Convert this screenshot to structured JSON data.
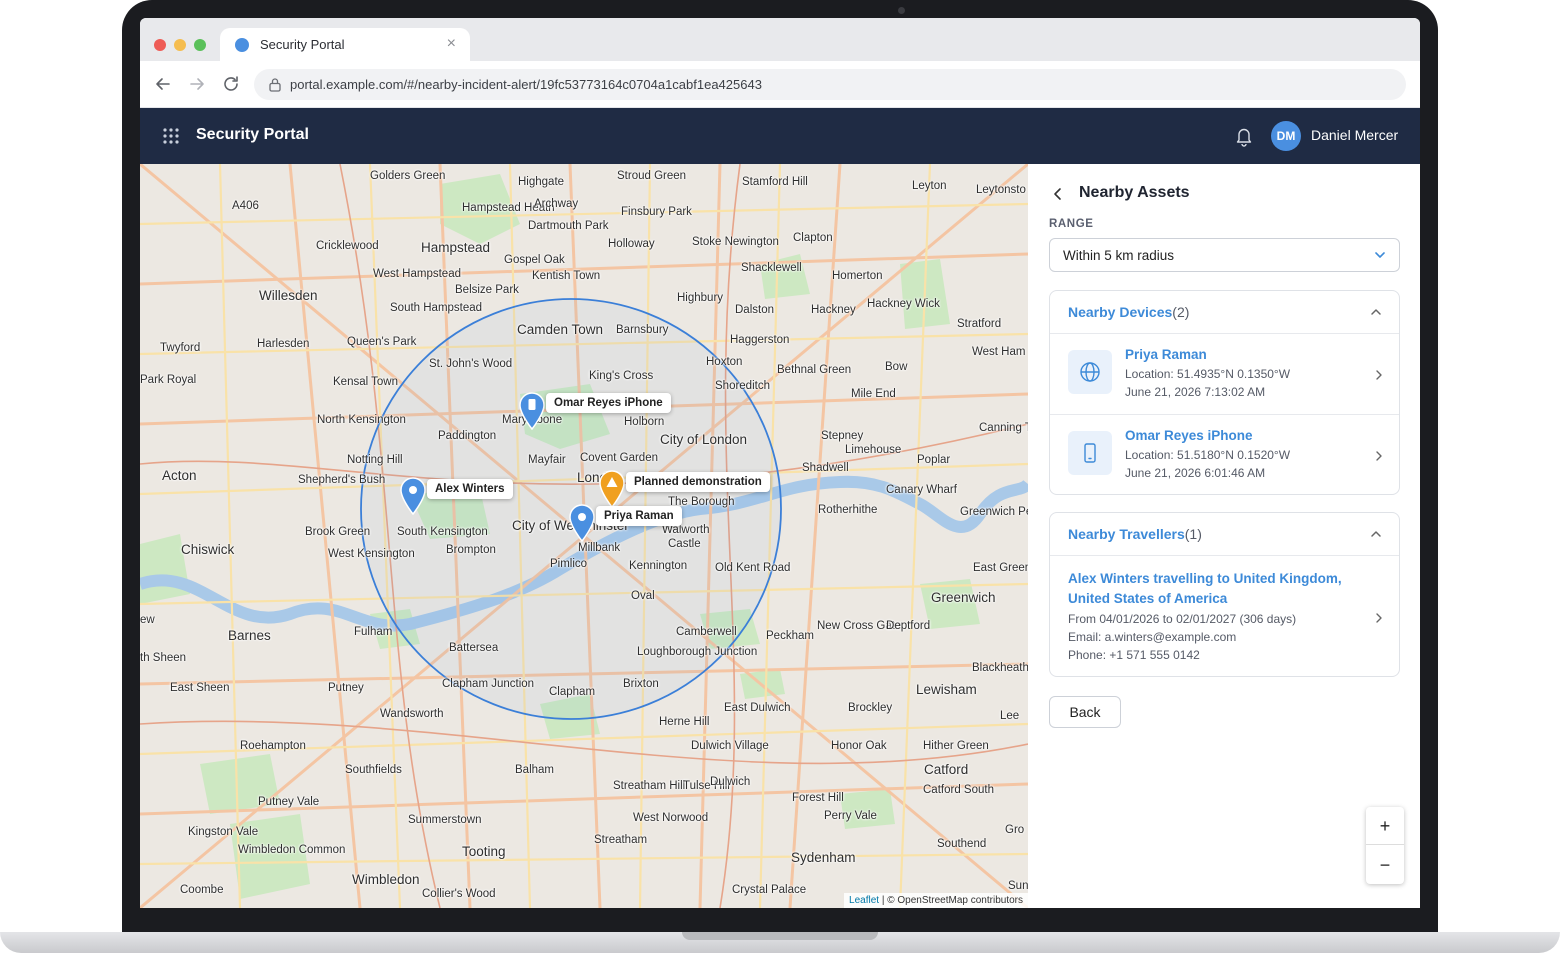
{
  "browser": {
    "tab_title": "Security Portal",
    "url": "portal.example.com/#/nearby-incident-alert/19fc53773164c0704a1cabf1ea425643"
  },
  "app": {
    "title": "Security Portal",
    "user_initials": "DM",
    "user_name": "Daniel Mercer"
  },
  "map": {
    "places": [
      {
        "name": "Golders Green"
      },
      {
        "name": "Highgate"
      },
      {
        "name": "Stroud Green"
      },
      {
        "name": "Stamford Hill"
      },
      {
        "name": "Leyton"
      },
      {
        "name": "Leytonsto"
      },
      {
        "name": "A406"
      },
      {
        "name": "Hampstead Heath"
      },
      {
        "name": "Archway"
      },
      {
        "name": "Finsbury Park"
      },
      {
        "name": "Dartmouth Park"
      },
      {
        "name": "Cricklewood"
      },
      {
        "name": "Hampstead"
      },
      {
        "name": "Holloway"
      },
      {
        "name": "Stoke Newington"
      },
      {
        "name": "Clapton"
      },
      {
        "name": "Gospel Oak"
      },
      {
        "name": "West Hampstead"
      },
      {
        "name": "Kentish Town"
      },
      {
        "name": "Shacklewell"
      },
      {
        "name": "Homerton"
      },
      {
        "name": "Willesden"
      },
      {
        "name": "Belsize Park"
      },
      {
        "name": "Highbury"
      },
      {
        "name": "Hackney Wick"
      },
      {
        "name": "South Hampstead"
      },
      {
        "name": "Dalston"
      },
      {
        "name": "Hackney"
      },
      {
        "name": "Stratford"
      },
      {
        "name": "Camden Town"
      },
      {
        "name": "Barnsbury"
      },
      {
        "name": "Twyford"
      },
      {
        "name": "Harlesden"
      },
      {
        "name": "Queen's Park"
      },
      {
        "name": "Haggerston"
      },
      {
        "name": "West Ham"
      },
      {
        "name": "Park Royal"
      },
      {
        "name": "Kensal Town"
      },
      {
        "name": "St. John's Wood"
      },
      {
        "name": "Hoxton"
      },
      {
        "name": "Bethnal Green"
      },
      {
        "name": "Bow"
      },
      {
        "name": "King's Cross"
      },
      {
        "name": "Shoreditch"
      },
      {
        "name": "Mile End"
      },
      {
        "name": "North Kensington"
      },
      {
        "name": "Marylebone"
      },
      {
        "name": "Holborn"
      },
      {
        "name": "Canning T"
      },
      {
        "name": "Paddington"
      },
      {
        "name": "City of London"
      },
      {
        "name": "Stepney"
      },
      {
        "name": "Notting Hill"
      },
      {
        "name": "Mayfair"
      },
      {
        "name": "Covent Garden"
      },
      {
        "name": "Limehouse"
      },
      {
        "name": "Poplar"
      },
      {
        "name": "Acton"
      },
      {
        "name": "Shepherd's Bush"
      },
      {
        "name": "Shadwell"
      },
      {
        "name": "Canary Wharf"
      },
      {
        "name": "London"
      },
      {
        "name": "The Borough"
      },
      {
        "name": "Rotherhithe"
      },
      {
        "name": "Greenwich Peninsula"
      },
      {
        "name": "City of Westminster"
      },
      {
        "name": "South Kensington"
      },
      {
        "name": "Walworth"
      },
      {
        "name": "Brook Green"
      },
      {
        "name": "Brompton"
      },
      {
        "name": "Castle"
      },
      {
        "name": "Chiswick"
      },
      {
        "name": "West Kensington"
      },
      {
        "name": "Millbank"
      },
      {
        "name": "Pimlico"
      },
      {
        "name": "Kennington"
      },
      {
        "name": "Old Kent Road"
      },
      {
        "name": "East Greenw"
      },
      {
        "name": "Oval"
      },
      {
        "name": "Greenwich"
      },
      {
        "name": "Barnes"
      },
      {
        "name": "Fulham"
      },
      {
        "name": "Camberwell"
      },
      {
        "name": "Peckham"
      },
      {
        "name": "New Cross Gate"
      },
      {
        "name": "Deptford"
      },
      {
        "name": "Battersea"
      },
      {
        "name": "Loughborough Junction"
      },
      {
        "name": "Blackheath"
      },
      {
        "name": "East Sheen"
      },
      {
        "name": "Putney"
      },
      {
        "name": "Clapham Junction"
      },
      {
        "name": "Brixton"
      },
      {
        "name": "Lewisham"
      },
      {
        "name": "Clapham"
      },
      {
        "name": "Wandsworth"
      },
      {
        "name": "Herne Hill"
      },
      {
        "name": "East Dulwich"
      },
      {
        "name": "Brockley"
      },
      {
        "name": "Lee"
      },
      {
        "name": "Roehampton"
      },
      {
        "name": "Dulwich Village"
      },
      {
        "name": "Honor Oak"
      },
      {
        "name": "Hither Green"
      },
      {
        "name": "Southfields"
      },
      {
        "name": "Balham"
      },
      {
        "name": "Catford"
      },
      {
        "name": "Streatham Hill"
      },
      {
        "name": "Tulse Hill"
      },
      {
        "name": "Dulwich"
      },
      {
        "name": "Catford South"
      },
      {
        "name": "Putney Vale"
      },
      {
        "name": "Forest Hill"
      },
      {
        "name": "Summerstown"
      },
      {
        "name": "West Norwood"
      },
      {
        "name": "Perry Vale"
      },
      {
        "name": "Kingston Vale"
      },
      {
        "name": "Gro"
      },
      {
        "name": "Wimbledon Common"
      },
      {
        "name": "Streatham"
      },
      {
        "name": "Southend"
      },
      {
        "name": "Tooting"
      },
      {
        "name": "Sydenham"
      },
      {
        "name": "Wimbledon"
      },
      {
        "name": "Coombe"
      },
      {
        "name": "Collier's Wood"
      },
      {
        "name": "Crystal Palace"
      },
      {
        "name": "Sun"
      },
      {
        "name": "ew"
      },
      {
        "name": "th Sheen"
      }
    ],
    "markers": [
      {
        "label": "Omar Reyes iPhone",
        "type": "device",
        "color": "#4a8fe0"
      },
      {
        "label": "Alex Winters",
        "type": "traveller",
        "color": "#4a8fe0"
      },
      {
        "label": "Planned demonstration",
        "type": "incident",
        "color": "#f0a020"
      },
      {
        "label": "Priya Raman",
        "type": "device",
        "color": "#4a8fe0"
      }
    ],
    "radius_circle_color": "#3b7fd8",
    "attribution_leaflet": "Leaflet",
    "attribution_osm": "| © OpenStreetMap contributors",
    "zoom_in": "+",
    "zoom_out": "−"
  },
  "panel": {
    "title": "Nearby Assets",
    "range_label": "RANGE",
    "range_value": "Within 5 km radius",
    "devices": {
      "title": "Nearby Devices",
      "count": "(2)",
      "items": [
        {
          "name": "Priya Raman",
          "location": "Location: 51.4935°N 0.1350°W",
          "time": "June 21, 2026 7:13:02 AM",
          "icon": "globe-icon"
        },
        {
          "name": "Omar Reyes iPhone",
          "location": "Location: 51.5180°N 0.1520°W",
          "time": "June 21, 2026 6:01:46 AM",
          "icon": "phone-icon"
        }
      ]
    },
    "travellers": {
      "title": "Nearby Travellers",
      "count": "(1)",
      "items": [
        {
          "name": "Alex Winters travelling to United Kingdom, United States of America",
          "dates": "From 04/01/2026 to 02/01/2027 (306 days)",
          "email": "Email: a.winters@example.com",
          "phone": "Phone: +1 571 555 0142"
        }
      ]
    },
    "back_label": "Back"
  }
}
